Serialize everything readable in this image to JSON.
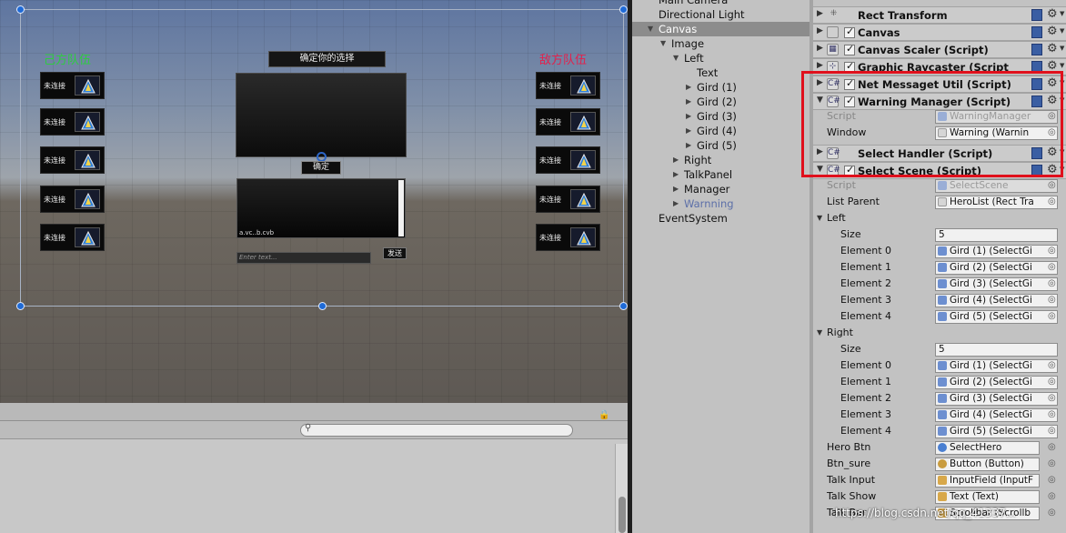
{
  "scene": {
    "left_team_title": "己方队伍",
    "right_team_title": "敌方队伍",
    "left_slots": [
      "未连接",
      "未连接",
      "未连接",
      "未连接",
      "未连接"
    ],
    "right_slots": [
      "未连接",
      "未连接",
      "未连接",
      "未连接",
      "未连接"
    ],
    "select_title": "确定你的选择",
    "confirm_button": "确定",
    "chat_text": "a.vc..b.cvb",
    "chat_input_placeholder": "Enter text...",
    "send_button": "发送",
    "colors": {
      "left_team": "#2ecc40",
      "right_team": "#e2224d",
      "handle": "#1f6ad6"
    }
  },
  "hierarchy": {
    "items": [
      {
        "label": "Main Camera",
        "arrow": ""
      },
      {
        "label": "Directional Light",
        "arrow": ""
      },
      {
        "label": "Canvas",
        "arrow": "▼",
        "selected": true
      },
      {
        "label": "Image",
        "arrow": "▼"
      },
      {
        "label": "Left",
        "arrow": "▼"
      },
      {
        "label": "Text",
        "arrow": ""
      },
      {
        "label": "Gird (1)",
        "arrow": "▶"
      },
      {
        "label": "Gird (2)",
        "arrow": "▶"
      },
      {
        "label": "Gird (3)",
        "arrow": "▶"
      },
      {
        "label": "Gird (4)",
        "arrow": "▶"
      },
      {
        "label": "Gird (5)",
        "arrow": "▶"
      },
      {
        "label": "Right",
        "arrow": "▶"
      },
      {
        "label": "TalkPanel",
        "arrow": "▶"
      },
      {
        "label": "Manager",
        "arrow": "▶"
      },
      {
        "label": "Warnning",
        "arrow": "▶",
        "disabled": true
      },
      {
        "label": "EventSystem",
        "arrow": ""
      }
    ]
  },
  "inspector": {
    "components": {
      "rect_transform": "Rect Transform",
      "canvas": "Canvas",
      "canvas_scaler": "Canvas Scaler (Script)",
      "graphic_raycaster": "Graphic Raycaster (Script",
      "net_message": "Net Messaget Util (Script)",
      "warning_manager": "Warning Manager (Script)",
      "select_handler": "Select Handler (Script)",
      "select_scene": "Select Scene (Script)"
    },
    "warning_props": {
      "script_label": "Script",
      "script_value": "WarningManager",
      "window_label": "Window",
      "window_value": "Warning (Warnin"
    },
    "select_props": {
      "script_label": "Script",
      "script_value": "SelectScene",
      "list_parent_label": "List Parent",
      "list_parent_value": "HeroList (Rect Tra",
      "left_label": "Left",
      "right_label": "Right",
      "size_label": "Size",
      "size_value": "5",
      "left_elements": [
        {
          "label": "Element 0",
          "value": "Gird (1) (SelectGi"
        },
        {
          "label": "Element 1",
          "value": "Gird (2) (SelectGi"
        },
        {
          "label": "Element 2",
          "value": "Gird (3) (SelectGi"
        },
        {
          "label": "Element 3",
          "value": "Gird (4) (SelectGi"
        },
        {
          "label": "Element 4",
          "value": "Gird (5) (SelectGi"
        }
      ],
      "right_elements": [
        {
          "label": "Element 0",
          "value": "Gird (1) (SelectGi"
        },
        {
          "label": "Element 1",
          "value": "Gird (2) (SelectGi"
        },
        {
          "label": "Element 2",
          "value": "Gird (3) (SelectGi"
        },
        {
          "label": "Element 3",
          "value": "Gird (4) (SelectGi"
        },
        {
          "label": "Element 4",
          "value": "Gird (5) (SelectGi"
        }
      ],
      "hero_btn_label": "Hero Btn",
      "hero_btn_value": "SelectHero",
      "btn_sure_label": "Btn_sure",
      "btn_sure_value": "Button (Button)",
      "talk_input_label": "Talk Input",
      "talk_input_value": "InputField (InputF",
      "talk_show_label": "Talk Show",
      "talk_show_value": "Text (Text)",
      "talk_bar_label": "Talk Bar",
      "talk_bar_value": "Scrollbar (Scrollb"
    },
    "highlight_color": "#e0101c"
  },
  "watermark": "https://blog.csdn.net/qq_41337..."
}
